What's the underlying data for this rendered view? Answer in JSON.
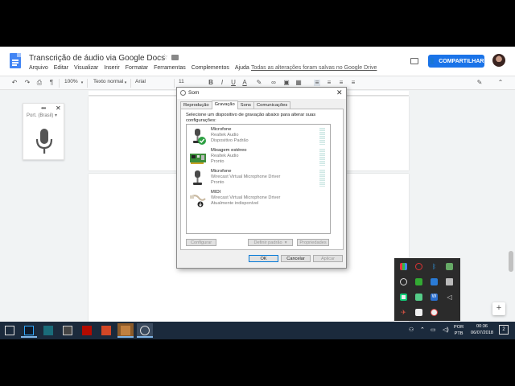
{
  "docs": {
    "title": "Transcrição de áudio via Google Docs",
    "menu": [
      "Arquivo",
      "Editar",
      "Visualizar",
      "Inserir",
      "Formatar",
      "Ferramentas",
      "Complementos",
      "Ajuda"
    ],
    "saved_message": "Todas as alterações foram salvas no Google Drive",
    "share_label": "COMPARTILHAR",
    "toolbar": {
      "zoom": "100%",
      "style": "Texto normal",
      "font": "Arial",
      "size": "11"
    }
  },
  "voice_typing": {
    "language": "Port. (Brasil)"
  },
  "sound_dialog": {
    "title": "Som",
    "tabs": [
      "Reprodução",
      "Gravação",
      "Sons",
      "Comunicações"
    ],
    "active_tab": "Gravação",
    "instruction": "Selecione um dispositivo de gravação abaixo para alterar suas configurações:",
    "devices": [
      {
        "name": "Microfone",
        "driver": "Realtek Audio",
        "status": "Dispositivo Padrão",
        "icon": "microphone-default-icon"
      },
      {
        "name": "Mixagem estéreo",
        "driver": "Realtek Audio",
        "status": "Pronto",
        "icon": "sound-card-icon"
      },
      {
        "name": "Microfone",
        "driver": "Wirecast Virtual Microphone Driver",
        "status": "Pronto",
        "icon": "microphone-icon"
      },
      {
        "name": "MIDI",
        "driver": "Wirecast Virtual Microphone Driver",
        "status": "Atualmente indisponível",
        "icon": "midi-cable-icon"
      }
    ],
    "buttons": {
      "configure": "Configurar",
      "set_default": "Definir padrão",
      "properties": "Propriedades",
      "ok": "OK",
      "cancel": "Cancelar",
      "apply": "Aplicar"
    }
  },
  "taskbar": {
    "language_top": "POR",
    "language_bottom": "PTB",
    "time": "00:36",
    "date": "06/07/2018",
    "notification_count": "2"
  },
  "colors": {
    "docs_blue": "#4285f4",
    "share_blue": "#1a73e8",
    "taskbar": "#1b2a3c",
    "default_check": "#2ea043"
  }
}
